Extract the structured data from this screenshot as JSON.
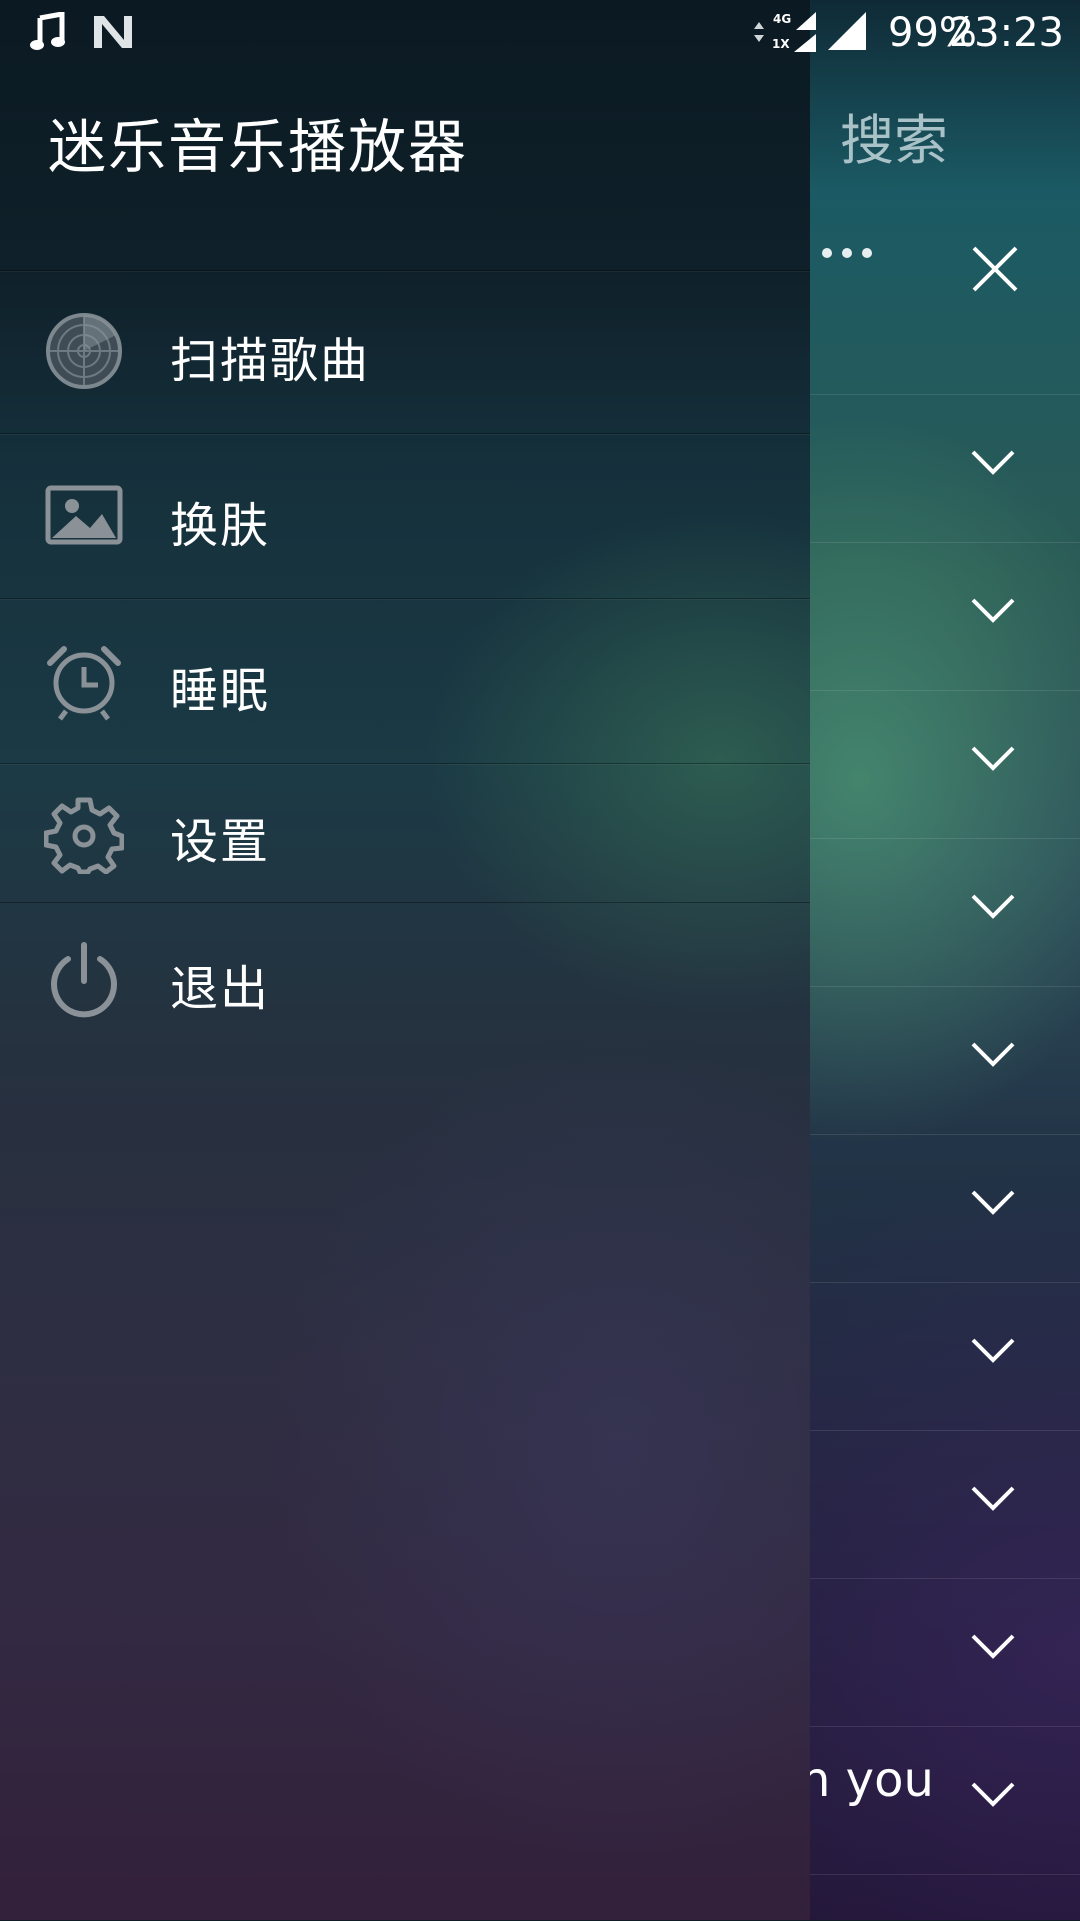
{
  "status_bar": {
    "battery": "99%",
    "time": "23:23",
    "network_top": "4G",
    "network_bottom": "1X",
    "icons": [
      "music-icon",
      "n-logo-icon",
      "data-arrows-icon",
      "signal-icon",
      "signal-icon"
    ]
  },
  "drawer": {
    "title": "迷乐音乐播放器",
    "menu": [
      {
        "label": "扫描歌曲",
        "icon": "radar-scan-icon"
      },
      {
        "label": "换肤",
        "icon": "image-icon"
      },
      {
        "label": "睡眠",
        "icon": "alarm-clock-icon"
      },
      {
        "label": "设置",
        "icon": "gear-icon"
      },
      {
        "label": "退出",
        "icon": "power-icon"
      }
    ]
  },
  "background": {
    "search_label": "搜索",
    "partial_song_text": "n you",
    "row_icon": "chevron-down-icon",
    "header_icons": [
      "more-dots-icon",
      "close-icon"
    ]
  },
  "colors": {
    "drawer_top": "#0b1a22",
    "drawer_bottom": "#33203a",
    "accent_green": "#3f7a64",
    "text": "#ffffff",
    "icon_gray": "#8a9298"
  }
}
